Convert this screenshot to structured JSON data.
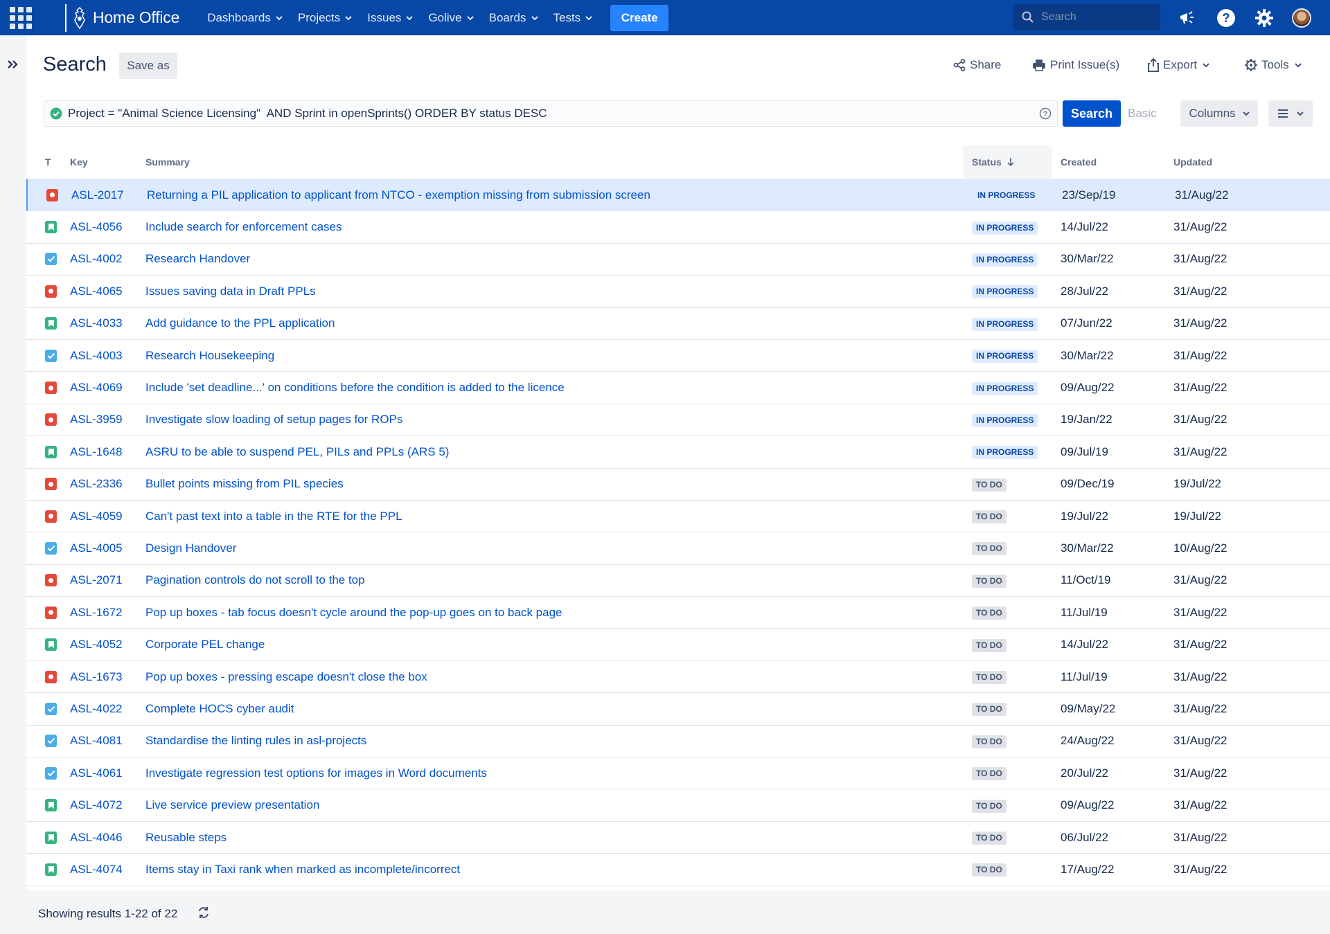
{
  "nav": {
    "brand": "Home Office",
    "menus": [
      "Dashboards",
      "Projects",
      "Issues",
      "Golive",
      "Boards",
      "Tests"
    ],
    "create_label": "Create",
    "search_placeholder": "Search",
    "accent": "#0747a6"
  },
  "header": {
    "title": "Search",
    "save_as": "Save as",
    "share": "Share",
    "print": "Print Issue(s)",
    "export": "Export",
    "tools": "Tools"
  },
  "query": {
    "jql": "Project = \"Animal Science Licensing\"  AND Sprint in openSprints() ORDER BY status DESC",
    "search_label": "Search",
    "basic_label": "Basic",
    "columns_label": "Columns"
  },
  "table": {
    "headers": {
      "type": "T",
      "key": "Key",
      "summary": "Summary",
      "status": "Status",
      "created": "Created",
      "updated": "Updated"
    },
    "rows": [
      {
        "type": "bug",
        "key": "ASL-2017",
        "summary": "Returning a PIL application to applicant from NTCO - exemption missing from submission screen",
        "status": "IN PROGRESS",
        "created": "23/Sep/19",
        "updated": "31/Aug/22"
      },
      {
        "type": "story",
        "key": "ASL-4056",
        "summary": "Include search for enforcement cases",
        "status": "IN PROGRESS",
        "created": "14/Jul/22",
        "updated": "31/Aug/22"
      },
      {
        "type": "task",
        "key": "ASL-4002",
        "summary": "Research Handover",
        "status": "IN PROGRESS",
        "created": "30/Mar/22",
        "updated": "31/Aug/22"
      },
      {
        "type": "bug",
        "key": "ASL-4065",
        "summary": "Issues saving data in Draft PPLs",
        "status": "IN PROGRESS",
        "created": "28/Jul/22",
        "updated": "31/Aug/22"
      },
      {
        "type": "story",
        "key": "ASL-4033",
        "summary": "Add guidance to the PPL application",
        "status": "IN PROGRESS",
        "created": "07/Jun/22",
        "updated": "31/Aug/22"
      },
      {
        "type": "task",
        "key": "ASL-4003",
        "summary": "Research Housekeeping",
        "status": "IN PROGRESS",
        "created": "30/Mar/22",
        "updated": "31/Aug/22"
      },
      {
        "type": "bug",
        "key": "ASL-4069",
        "summary": "Include 'set deadline...' on conditions before the condition is added to the licence",
        "status": "IN PROGRESS",
        "created": "09/Aug/22",
        "updated": "31/Aug/22"
      },
      {
        "type": "bug",
        "key": "ASL-3959",
        "summary": "Investigate slow loading of setup pages for ROPs",
        "status": "IN PROGRESS",
        "created": "19/Jan/22",
        "updated": "31/Aug/22"
      },
      {
        "type": "story",
        "key": "ASL-1648",
        "summary": "ASRU to be able to suspend PEL, PILs and PPLs (ARS 5)",
        "status": "IN PROGRESS",
        "created": "09/Jul/19",
        "updated": "31/Aug/22"
      },
      {
        "type": "bug",
        "key": "ASL-2336",
        "summary": "Bullet points missing from PIL species",
        "status": "TO DO",
        "created": "09/Dec/19",
        "updated": "19/Jul/22"
      },
      {
        "type": "bug",
        "key": "ASL-4059",
        "summary": "Can't past text into a table in the RTE for the PPL",
        "status": "TO DO",
        "created": "19/Jul/22",
        "updated": "19/Jul/22"
      },
      {
        "type": "task",
        "key": "ASL-4005",
        "summary": "Design Handover",
        "status": "TO DO",
        "created": "30/Mar/22",
        "updated": "10/Aug/22"
      },
      {
        "type": "bug",
        "key": "ASL-2071",
        "summary": "Pagination controls do not scroll to the top",
        "status": "TO DO",
        "created": "11/Oct/19",
        "updated": "31/Aug/22"
      },
      {
        "type": "bug",
        "key": "ASL-1672",
        "summary": "Pop up boxes - tab focus doesn't cycle around the pop-up goes on to back page",
        "status": "TO DO",
        "created": "11/Jul/19",
        "updated": "31/Aug/22"
      },
      {
        "type": "story",
        "key": "ASL-4052",
        "summary": "Corporate PEL change",
        "status": "TO DO",
        "created": "14/Jul/22",
        "updated": "31/Aug/22"
      },
      {
        "type": "bug",
        "key": "ASL-1673",
        "summary": "Pop up boxes - pressing escape doesn't close the box",
        "status": "TO DO",
        "created": "11/Jul/19",
        "updated": "31/Aug/22"
      },
      {
        "type": "task",
        "key": "ASL-4022",
        "summary": "Complete HOCS cyber audit",
        "status": "TO DO",
        "created": "09/May/22",
        "updated": "31/Aug/22"
      },
      {
        "type": "task",
        "key": "ASL-4081",
        "summary": "Standardise the linting rules in asl-projects",
        "status": "TO DO",
        "created": "24/Aug/22",
        "updated": "31/Aug/22"
      },
      {
        "type": "task",
        "key": "ASL-4061",
        "summary": "Investigate regression test options for images in Word documents",
        "status": "TO DO",
        "created": "20/Jul/22",
        "updated": "31/Aug/22"
      },
      {
        "type": "story",
        "key": "ASL-4072",
        "summary": "Live service preview presentation",
        "status": "TO DO",
        "created": "09/Aug/22",
        "updated": "31/Aug/22"
      },
      {
        "type": "story",
        "key": "ASL-4046",
        "summary": "Reusable steps",
        "status": "TO DO",
        "created": "06/Jul/22",
        "updated": "31/Aug/22"
      },
      {
        "type": "story",
        "key": "ASL-4074",
        "summary": "Items stay in Taxi rank when marked as incomplete/incorrect",
        "status": "TO DO",
        "created": "17/Aug/22",
        "updated": "31/Aug/22"
      }
    ]
  },
  "footer": {
    "results_text": "Showing results 1-22 of 22"
  }
}
